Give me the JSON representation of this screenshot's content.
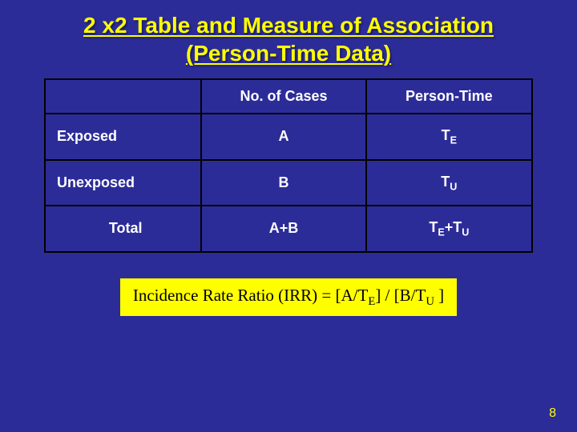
{
  "title_line1": "2 x2 Table and Measure of Association",
  "title_line2": "(Person-Time Data)",
  "table": {
    "col_blank": "",
    "col_cases": "No. of Cases",
    "col_pt": "Person-Time",
    "rows": [
      {
        "label": "Exposed",
        "cases": "A",
        "pt_pre": "T",
        "pt_sub": "E"
      },
      {
        "label": "Unexposed",
        "cases": "B",
        "pt_pre": "T",
        "pt_sub": "U"
      }
    ],
    "total": {
      "label": "Total",
      "cases": "A+B",
      "pt_pre1": "T",
      "pt_sub1": "E",
      "plus": "+",
      "pt_pre2": "T",
      "pt_sub2": "U"
    }
  },
  "formula": {
    "lead": "Incidence Rate Ratio (IRR) = [A/T",
    "sub1": "E",
    "mid": "] / [B/T",
    "sub2": "U",
    "tail": " ]"
  },
  "page_number": "8",
  "chart_data": {
    "type": "table",
    "title": "2x2 Table and Measure of Association (Person-Time Data)",
    "columns": [
      "",
      "No. of Cases",
      "Person-Time"
    ],
    "rows": [
      [
        "Exposed",
        "A",
        "T_E"
      ],
      [
        "Unexposed",
        "B",
        "T_U"
      ],
      [
        "Total",
        "A+B",
        "T_E+T_U"
      ]
    ],
    "formula": "Incidence Rate Ratio (IRR) = [A/T_E] / [B/T_U]"
  }
}
